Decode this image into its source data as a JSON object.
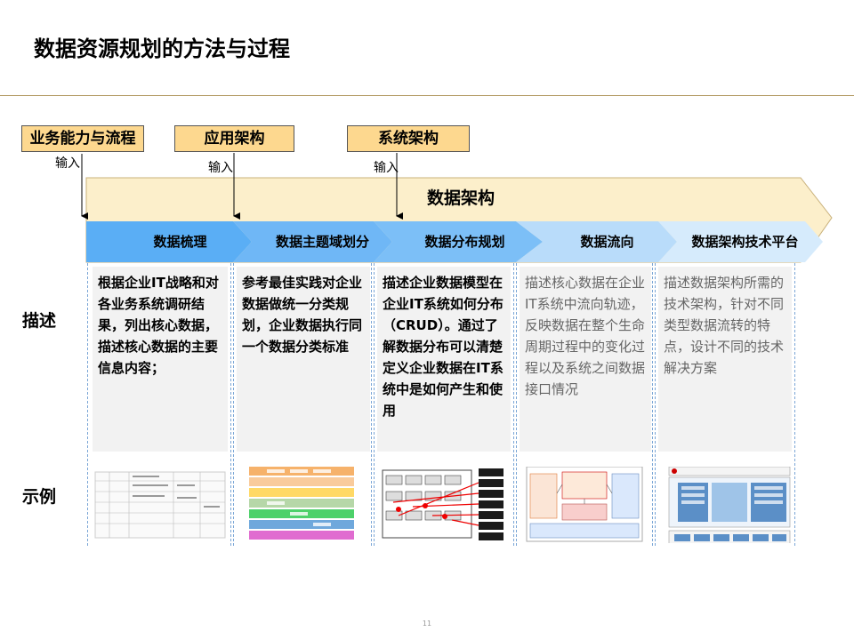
{
  "title": "数据资源规划的方法与过程",
  "inputs": [
    {
      "label": "业务能力与流程",
      "arrow_label": "输入"
    },
    {
      "label": "应用架构",
      "arrow_label": "输入"
    },
    {
      "label": "系统架构",
      "arrow_label": "输入"
    }
  ],
  "architecture_label": "数据架构",
  "stages": [
    "数据梳理",
    "数据主题域划分",
    "数据分布规划",
    "数据流向",
    "数据架构技术平台"
  ],
  "rows": {
    "description": "描述",
    "example": "示例"
  },
  "descriptions": [
    "根据企业IT战略和对各业务系统调研结果，列出核心数据，描述核心数据的主要信息内容；",
    "参考最佳实践对企业数据做统一分类规划，企业数据执行同一个数据分类标准",
    "描述企业数据模型在企业IT系统如何分布（CRUD）。通过了解数据分布可以清楚定义企业数据在IT系统中是如何产生和使用",
    "描述核心数据在企业IT系统中流向轨迹，反映数据在整个生命周期过程中的变化过程以及系统之间数据接口情况",
    "描述数据架构所需的技术架构，针对不同类型数据流转的特点，设计不同的技术解决方案"
  ],
  "colors": {
    "input_box": "#fdd88f",
    "architecture_band": "#fcefcb",
    "stage_dark": "#5aaef5",
    "stage_light": "#cfe6fb",
    "rule": "#b39b64"
  },
  "page_number": "11"
}
